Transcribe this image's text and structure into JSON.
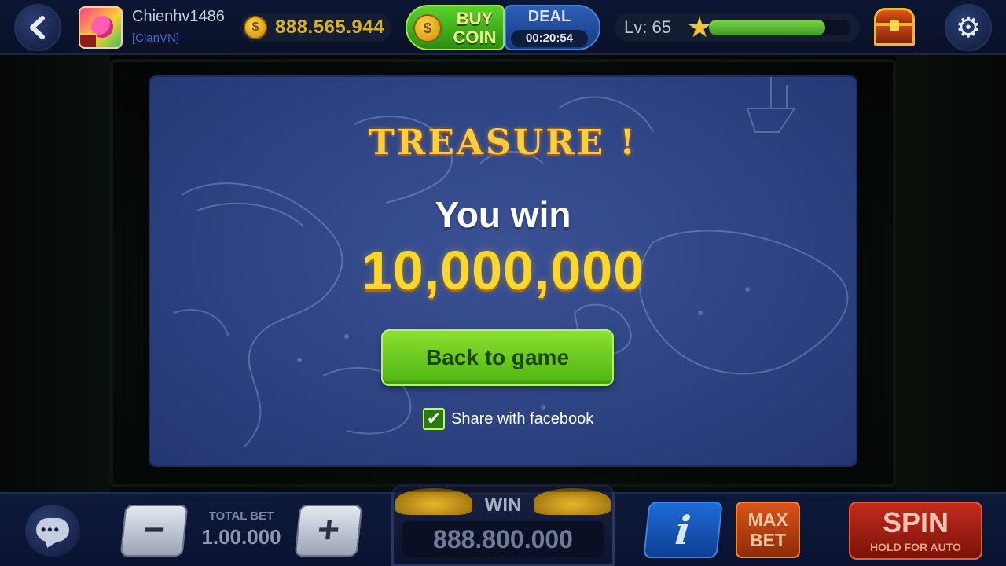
{
  "player": {
    "username": "Chienhv1486",
    "clan": "[ClanVN]",
    "coins": "888.565.944",
    "level_label": "Lv: 65",
    "level_progress": 0.82
  },
  "shop": {
    "buy_coin_label": "BUY COIN",
    "deal_label": "DEAL",
    "deal_timer": "00:20:54"
  },
  "modal": {
    "title": "TREASURE !",
    "subtitle": "You win",
    "amount": "10,000,000",
    "back_button": "Back to game",
    "share_checked": true,
    "share_label": "Share with facebook"
  },
  "bottom": {
    "total_bet_label": "TOTAL BET",
    "total_bet_value": "1.00.000",
    "win_label": "WIN",
    "win_value": "888.800.000",
    "info_label": "i",
    "maxbet_label": "MAX BET",
    "spin_label": "SPIN",
    "spin_sub": "HOLD FOR AUTO"
  },
  "icons": {
    "back": "chevron-left-icon",
    "coin": "coin-icon",
    "star": "star-icon",
    "chest": "treasure-chest-icon",
    "settings": "gear-icon",
    "chat": "chat-bubble-icon",
    "check": "checkmark-icon"
  },
  "colors": {
    "modal_bg": "#2d4382",
    "title_gold": "#ffce3a",
    "amount_gold": "#ffd62a",
    "button_green": "#6cc81f",
    "spin_red": "#c22b1c",
    "info_blue": "#1f6bd6"
  }
}
